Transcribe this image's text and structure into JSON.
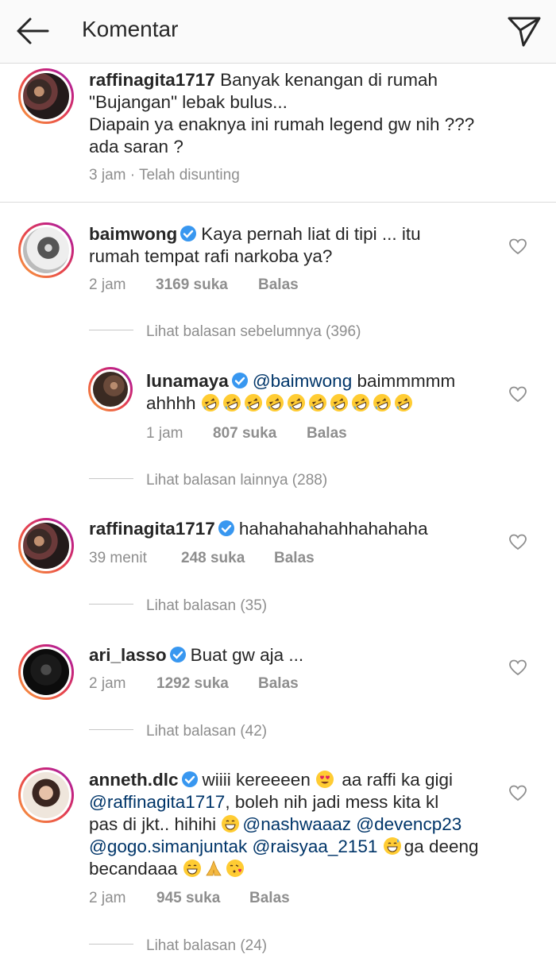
{
  "header": {
    "title": "Komentar"
  },
  "caption": {
    "username": "raffinagita1717",
    "line1": "Banyak kenangan di rumah",
    "line2": "\"Bujangan\" lebak bulus...",
    "line3": "Diapain ya enaknya ini rumah legend gw nih ???",
    "line4": "ada saran ?",
    "meta": "3 jam · Telah disunting"
  },
  "comments": [
    {
      "username": "baimwong",
      "line1": "Kaya pernah liat di tipi ... itu",
      "line2": "rumah tempat rafi narkoba ya?",
      "time": "2 jam",
      "likes": "3169 suka",
      "reply": "Balas",
      "view_replies": "Lihat balasan sebelumnya (396)"
    },
    {
      "username": "lunamaya",
      "mention": "@baimwong",
      "line1_rest": "baimmmmm",
      "line2": "ahhhh",
      "emoji_count": 10,
      "time": "1 jam",
      "likes": "807 suka",
      "reply": "Balas",
      "view_replies": "Lihat balasan lainnya (288)"
    },
    {
      "username": "raffinagita1717",
      "line1": "hahahahahahhahahaha",
      "time": "39 menit",
      "likes": "248 suka",
      "reply": "Balas",
      "view_replies": "Lihat balasan (35)"
    },
    {
      "username": "ari_lasso",
      "line1": "Buat gw aja ...",
      "time": "2 jam",
      "likes": "1292 suka",
      "reply": "Balas",
      "view_replies": "Lihat balasan (42)"
    },
    {
      "username": "anneth.dlc",
      "l1a": "wiiii kereeeen",
      "l1b": "aa raffi ka gigi",
      "mention1": "@raffinagita1717",
      "l2b": ", boleh nih jadi mess kita kl",
      "l3a": "pas di jkt.. hihihi",
      "mention2": "@nashwaaaz",
      "mention3": "@devencp23",
      "mention4": "@gogo.simanjuntak",
      "mention5": "@raisyaa_2151",
      "l4b": "ga deeng",
      "l5a": "becandaaa",
      "time": "2 jam",
      "likes": "945 suka",
      "reply": "Balas",
      "view_replies": "Lihat balasan (24)"
    }
  ],
  "colors": {
    "text": "#262626",
    "muted": "#8e8e8e",
    "mention": "#003569",
    "verified": "#3897f0"
  }
}
